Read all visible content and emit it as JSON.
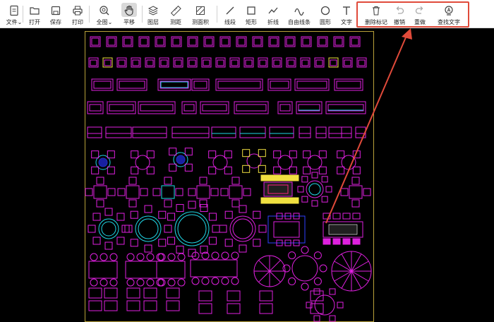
{
  "toolbar": {
    "items": [
      {
        "name": "file",
        "label": "文件",
        "icon": "file-icon"
      },
      {
        "name": "open",
        "label": "打开",
        "icon": "folder-icon"
      },
      {
        "name": "save",
        "label": "保存",
        "icon": "save-icon"
      },
      {
        "name": "print",
        "label": "打印",
        "icon": "printer-icon"
      },
      {
        "name": "fullview",
        "label": "全图",
        "icon": "zoom-fit-icon"
      },
      {
        "name": "pan",
        "label": "平移",
        "icon": "hand-icon"
      },
      {
        "name": "layers",
        "label": "图层",
        "icon": "layers-icon"
      },
      {
        "name": "measure",
        "label": "测距",
        "icon": "ruler-icon"
      },
      {
        "name": "area",
        "label": "测面积",
        "icon": "area-icon"
      },
      {
        "name": "line",
        "label": "线段",
        "icon": "line-icon"
      },
      {
        "name": "rect",
        "label": "矩形",
        "icon": "rectangle-icon"
      },
      {
        "name": "polyline",
        "label": "折线",
        "icon": "polyline-icon"
      },
      {
        "name": "freeline",
        "label": "自由线条",
        "icon": "freehand-icon"
      },
      {
        "name": "circle",
        "label": "圆形",
        "icon": "circle-icon"
      },
      {
        "name": "text",
        "label": "文字",
        "icon": "text-icon"
      },
      {
        "name": "delete-mark",
        "label": "删除标记",
        "icon": "trash-icon"
      },
      {
        "name": "undo",
        "label": "撤销",
        "icon": "undo-icon"
      },
      {
        "name": "redo",
        "label": "重做",
        "icon": "redo-icon"
      },
      {
        "name": "find-text",
        "label": "查找文字",
        "icon": "search-text-icon"
      }
    ],
    "active": "平移"
  },
  "colors": {
    "canvas": "#000000",
    "cad_magenta": "#e020e0",
    "cad_cyan": "#20d8e8",
    "cad_yellow": "#f0e040",
    "highlight": "#e04a3a"
  }
}
